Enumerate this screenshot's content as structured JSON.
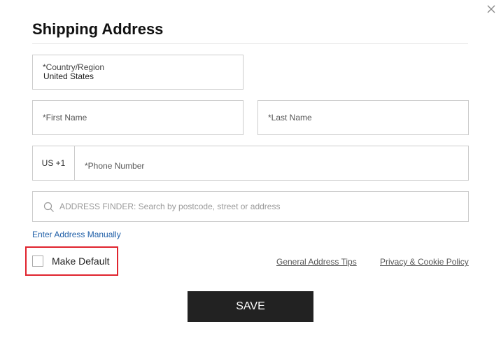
{
  "dialog": {
    "title": "Shipping Address"
  },
  "icons": {
    "close": "close-icon",
    "search": "search-icon"
  },
  "form": {
    "country": {
      "label": "*Country/Region",
      "value": "United States"
    },
    "first_name": {
      "placeholder": "*First Name",
      "value": ""
    },
    "last_name": {
      "placeholder": "*Last Name",
      "value": ""
    },
    "phone": {
      "code": "US +1",
      "placeholder": "*Phone Number",
      "value": ""
    },
    "address_finder": {
      "placeholder": "ADDRESS FINDER: Search by postcode, street or address",
      "value": ""
    },
    "manual_entry_label": "Enter Address Manually",
    "make_default": {
      "label": "Make Default",
      "checked": false
    },
    "general_tips_label": "General Address Tips",
    "privacy_label": "Privacy & Cookie Policy",
    "save_label": "SAVE"
  },
  "colors": {
    "link_blue": "#2160a8",
    "highlight_red": "#e0242e",
    "button_dark": "#222222"
  }
}
